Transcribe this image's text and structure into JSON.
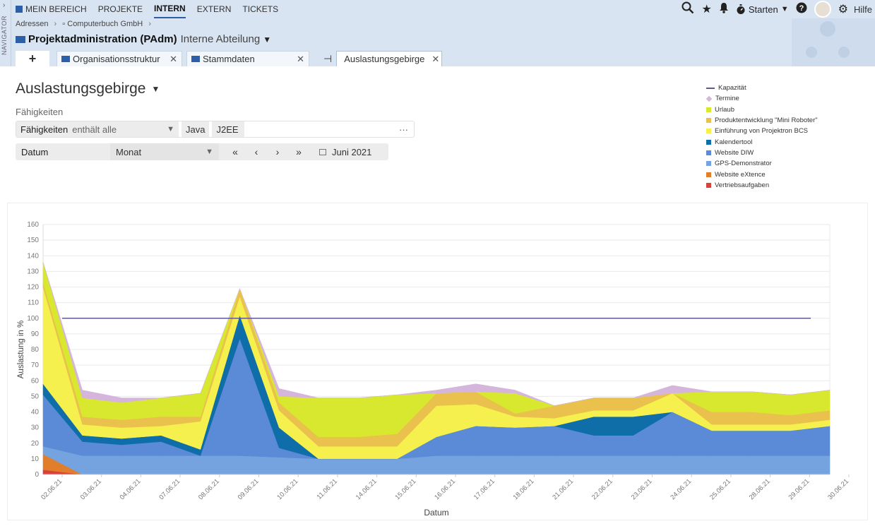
{
  "navigator": {
    "label": "NAVIGATOR"
  },
  "mainnav": {
    "items": [
      "MEIN BEREICH",
      "PROJEKTE",
      "INTERN",
      "EXTERN",
      "TICKETS"
    ]
  },
  "header_tools": {
    "starten_label": "Starten",
    "hilfe_label": "Hilfe"
  },
  "breadcrumb": {
    "items": [
      "Adressen",
      "Computerbuch GmbH"
    ]
  },
  "title": {
    "main": "Projektadministration (PAdm)",
    "sub": "Interne Abteilung"
  },
  "tabs": [
    {
      "label": "Organisationsstruktur",
      "active": false
    },
    {
      "label": "Stammdaten",
      "active": false
    },
    {
      "label": "Auslastungsgebirge",
      "active": true
    }
  ],
  "page": {
    "title": "Auslastungsgebirge"
  },
  "filter": {
    "section_label": "Fähigkeiten",
    "field_label": "Fähigkeiten",
    "operator": "enthält alle",
    "values": [
      "Java",
      "J2EE"
    ],
    "more": "···"
  },
  "date_filter": {
    "label": "Datum",
    "period": "Monat",
    "month": "Juni 2021"
  },
  "chart_data": {
    "type": "area",
    "stacked": true,
    "xlabel": "Datum",
    "ylabel": "Auslastung in %",
    "ylim": [
      0,
      160
    ],
    "yticks": [
      0,
      10,
      20,
      30,
      40,
      50,
      60,
      70,
      80,
      90,
      100,
      110,
      120,
      130,
      140,
      150,
      160
    ],
    "categories": [
      "02.06.21",
      "03.06.21",
      "04.06.21",
      "07.06.21",
      "08.06.21",
      "09.06.21",
      "10.06.21",
      "11.06.21",
      "14.06.21",
      "15.06.21",
      "16.06.21",
      "17.06.21",
      "18.06.21",
      "21.06.21",
      "22.06.21",
      "23.06.21",
      "24.06.21",
      "25.06.21",
      "28.06.21",
      "29.06.21",
      "30.06.21"
    ],
    "capacity": {
      "name": "Kapazität",
      "color": "#5e5a8f",
      "value": 100
    },
    "series": [
      {
        "name": "Vertriebsaufgaben",
        "color": "#d9413b",
        "values": [
          3,
          0,
          0,
          0,
          0,
          0,
          0,
          0,
          0,
          0,
          0,
          0,
          0,
          0,
          0,
          0,
          0,
          0,
          0,
          0,
          0
        ]
      },
      {
        "name": "Website eXtence",
        "color": "#e07e2c",
        "values": [
          10,
          0,
          0,
          0,
          0,
          0,
          0,
          0,
          0,
          0,
          0,
          0,
          0,
          0,
          0,
          0,
          0,
          0,
          0,
          0,
          0
        ]
      },
      {
        "name": "GPS-Demonstrator",
        "color": "#74a3df",
        "values": [
          5,
          12,
          12,
          12,
          12,
          12,
          11,
          10,
          10,
          10,
          12,
          12,
          12,
          12,
          12,
          12,
          12,
          12,
          12,
          12,
          12
        ]
      },
      {
        "name": "Website DIW",
        "color": "#5b8ad6",
        "values": [
          33,
          9,
          7,
          9,
          0,
          75,
          6,
          0,
          0,
          0,
          12,
          19,
          18,
          19,
          13,
          13,
          28,
          16,
          16,
          16,
          19
        ]
      },
      {
        "name": "Kalendertool",
        "color": "#0f6ea8",
        "values": [
          7,
          4,
          4,
          4,
          4,
          15,
          13,
          0,
          0,
          0,
          0,
          0,
          0,
          0,
          12,
          12,
          0,
          0,
          0,
          0,
          0
        ]
      },
      {
        "name": "Einführung von Projektron BCS",
        "color": "#f5f04d",
        "values": [
          62,
          7,
          7,
          6,
          18,
          12,
          11,
          8,
          8,
          8,
          20,
          14,
          7,
          5,
          4,
          4,
          12,
          4,
          4,
          4,
          4
        ]
      },
      {
        "name": "Produktentwicklung \"Mini Roboter\"",
        "color": "#e9c14c",
        "values": [
          3,
          5,
          5,
          6,
          3,
          5,
          5,
          6,
          6,
          8,
          8,
          8,
          2,
          8,
          8,
          8,
          0,
          8,
          8,
          6,
          6
        ]
      },
      {
        "name": "Urlaub",
        "color": "#d8e82e",
        "values": [
          13,
          12,
          11,
          12,
          15,
          0,
          4,
          25,
          25,
          25,
          0,
          0,
          13,
          0,
          0,
          0,
          0,
          13,
          13,
          13,
          13
        ]
      },
      {
        "name": "Termine",
        "color": "#d5b5db",
        "values": [
          0,
          5,
          3,
          0,
          0,
          0,
          5,
          0,
          0,
          0,
          2,
          5,
          2,
          0,
          0,
          0,
          5,
          0,
          0,
          0,
          0
        ]
      }
    ],
    "legend_order": [
      "Kapazität",
      "Termine",
      "Urlaub",
      "Produktentwicklung \"Mini Roboter\"",
      "Einführung von Projektron BCS",
      "Kalendertool",
      "Website DIW",
      "GPS-Demonstrator",
      "Website eXtence",
      "Vertriebsaufgaben"
    ],
    "legend_position": "top-right",
    "grid": true
  }
}
